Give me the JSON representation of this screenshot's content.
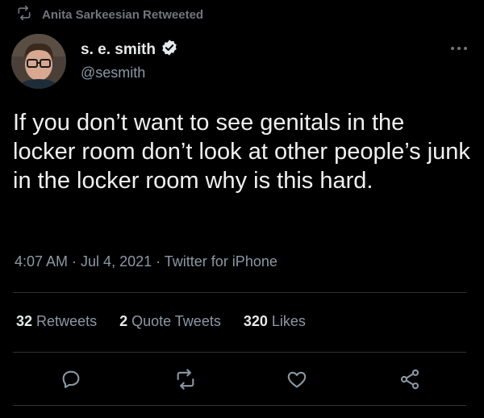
{
  "retweet_context": {
    "icon": "retweet-icon",
    "label": "Anita Sarkeesian Retweeted"
  },
  "author": {
    "display_name": "s. e. smith",
    "handle": "@sesmith",
    "verified": true,
    "avatar_icon": "avatar"
  },
  "tweet": {
    "text": "If you don’t want to see genitals in the locker room don’t look at other people’s junk in the locker room why is this hard.",
    "time": "4:07 AM",
    "date": "Jul 4, 2021",
    "source": "Twitter for iPhone",
    "meta_separator": " · "
  },
  "stats": {
    "retweets": {
      "count": "32",
      "label": "Retweets"
    },
    "quote_tweets": {
      "count": "2",
      "label": "Quote Tweets"
    },
    "likes": {
      "count": "320",
      "label": "Likes"
    }
  },
  "actions": [
    {
      "icon": "reply-icon"
    },
    {
      "icon": "retweet-icon"
    },
    {
      "icon": "like-icon"
    },
    {
      "icon": "share-icon"
    }
  ],
  "colors": {
    "background": "#000000",
    "text_primary": "#e7e9ea",
    "text_secondary": "#8b98a5",
    "divider": "#2f3336"
  }
}
